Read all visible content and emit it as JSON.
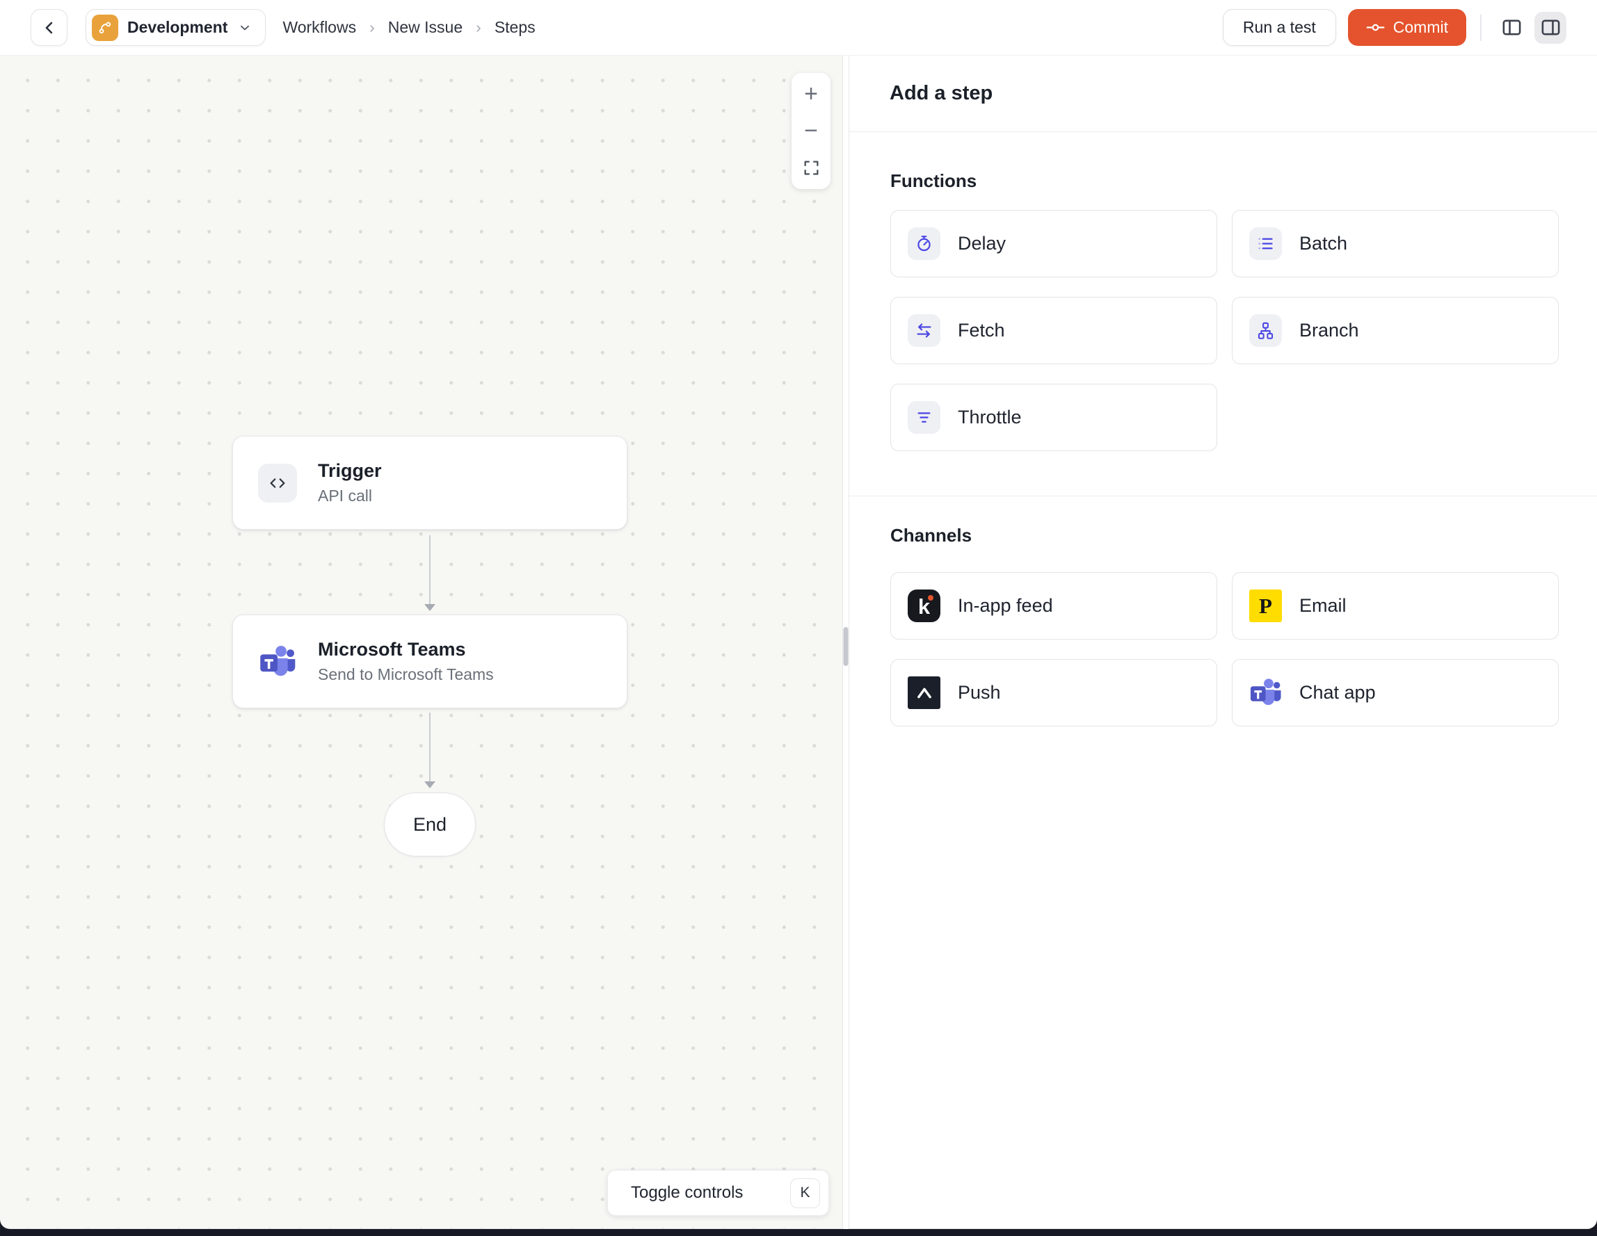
{
  "header": {
    "environment_switcher": {
      "label": "Development"
    },
    "breadcrumb": {
      "items": [
        "Workflows",
        "New Issue",
        "Steps"
      ],
      "separator": "›"
    },
    "run_test_button": "Run a test",
    "commit_button": "Commit"
  },
  "canvas": {
    "zoom_in": "+",
    "zoom_out": "−",
    "nodes": {
      "trigger": {
        "title": "Trigger",
        "subtitle": "API call",
        "icon": "code-icon"
      },
      "teams": {
        "title": "Microsoft Teams",
        "subtitle": "Send to Microsoft Teams",
        "icon": "microsoft-teams-icon"
      },
      "end": {
        "label": "End"
      }
    },
    "toggle_controls": {
      "label": "Toggle controls",
      "shortcut": "K"
    }
  },
  "panel": {
    "title": "Add a step",
    "functions": {
      "heading": "Functions",
      "items": [
        {
          "label": "Delay",
          "icon": "delay-stopwatch-icon"
        },
        {
          "label": "Batch",
          "icon": "batch-list-icon"
        },
        {
          "label": "Fetch",
          "icon": "fetch-arrows-icon"
        },
        {
          "label": "Branch",
          "icon": "branch-hierarchy-icon"
        },
        {
          "label": "Throttle",
          "icon": "throttle-filter-icon"
        }
      ]
    },
    "channels": {
      "heading": "Channels",
      "items": [
        {
          "label": "In-app feed",
          "icon": "knock-in-app-icon"
        },
        {
          "label": "Email",
          "icon": "postmark-email-icon"
        },
        {
          "label": "Push",
          "icon": "expo-push-icon"
        },
        {
          "label": "Chat app",
          "icon": "microsoft-teams-icon"
        }
      ]
    }
  },
  "colors": {
    "commit_orange": "#E4532D",
    "environment_badge_orange": "#E9A23B",
    "function_icon_indigo": "#4945E4",
    "teams_purple": "#5059C9",
    "teams_purple_light": "#7B83EB",
    "teams_purple_dark": "#4E55C4",
    "knock_black": "#17191E",
    "postmark_yellow": "#FFDD00",
    "expo_dark": "#1B1F2A",
    "canvas_background": "#F7F7F4"
  }
}
